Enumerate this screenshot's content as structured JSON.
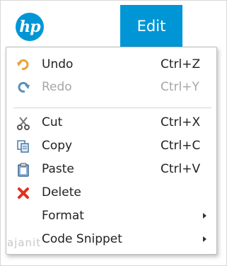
{
  "header": {
    "logo_text": "hp",
    "edit_tab_label": "Edit"
  },
  "menu": {
    "items": [
      {
        "label": "Undo",
        "shortcut": "Ctrl+Z",
        "icon": "undo-icon",
        "enabled": true
      },
      {
        "label": "Redo",
        "shortcut": "Ctrl+Y",
        "icon": "redo-icon",
        "enabled": false
      },
      {
        "label": "Cut",
        "shortcut": "Ctrl+X",
        "icon": "scissors-icon",
        "enabled": true
      },
      {
        "label": "Copy",
        "shortcut": "Ctrl+C",
        "icon": "copy-icon",
        "enabled": true
      },
      {
        "label": "Paste",
        "shortcut": "Ctrl+V",
        "icon": "clipboard-icon",
        "enabled": true
      },
      {
        "label": "Delete",
        "shortcut": "",
        "icon": "delete-x-icon",
        "enabled": true
      },
      {
        "label": "Format",
        "shortcut": "",
        "icon": "",
        "submenu": true,
        "enabled": true
      },
      {
        "label": "Code Snippet",
        "shortcut": "",
        "icon": "",
        "submenu": true,
        "enabled": true
      }
    ]
  },
  "watermark": "ajanit",
  "colors": {
    "accent": "#0096d6",
    "text": "#222222",
    "disabled_text": "#a6a6a6",
    "delete_red": "#e0301e"
  }
}
